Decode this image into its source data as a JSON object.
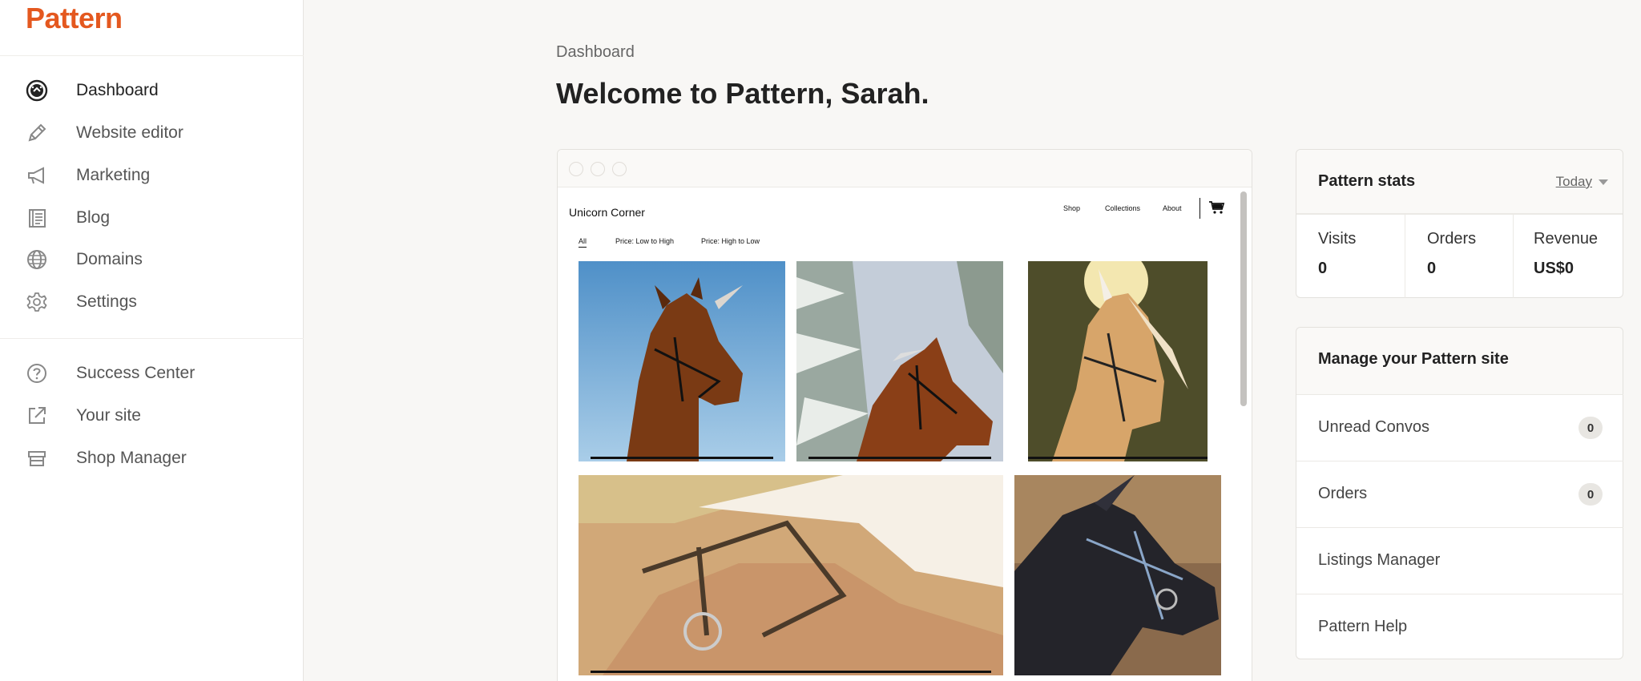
{
  "brand": {
    "logo": "Pattern",
    "accent": "#e4581f"
  },
  "sidebar": {
    "primary": [
      {
        "label": "Dashboard",
        "icon": "dashboard-icon",
        "active": true
      },
      {
        "label": "Website editor",
        "icon": "pencil-icon"
      },
      {
        "label": "Marketing",
        "icon": "megaphone-icon"
      },
      {
        "label": "Blog",
        "icon": "blog-icon"
      },
      {
        "label": "Domains",
        "icon": "globe-icon"
      },
      {
        "label": "Settings",
        "icon": "gear-icon"
      }
    ],
    "secondary": [
      {
        "label": "Success Center",
        "icon": "help-circle-icon"
      },
      {
        "label": "Your site",
        "icon": "external-link-icon"
      },
      {
        "label": "Shop Manager",
        "icon": "store-icon"
      }
    ]
  },
  "main": {
    "breadcrumb": "Dashboard",
    "title": "Welcome to Pattern, Sarah."
  },
  "preview": {
    "shop_name": "Unicorn Corner",
    "nav": [
      "Shop",
      "Collections",
      "About"
    ],
    "filters": [
      "All",
      "Price: Low to High",
      "Price: High to Low"
    ]
  },
  "stats": {
    "title": "Pattern stats",
    "period": "Today",
    "items": [
      {
        "label": "Visits",
        "value": "0"
      },
      {
        "label": "Orders",
        "value": "0"
      },
      {
        "label": "Revenue",
        "value": "US$0"
      }
    ]
  },
  "manage": {
    "title": "Manage your Pattern site",
    "rows": [
      {
        "label": "Unread Convos",
        "badge": "0"
      },
      {
        "label": "Orders",
        "badge": "0"
      },
      {
        "label": "Listings Manager"
      },
      {
        "label": "Pattern Help"
      }
    ]
  }
}
